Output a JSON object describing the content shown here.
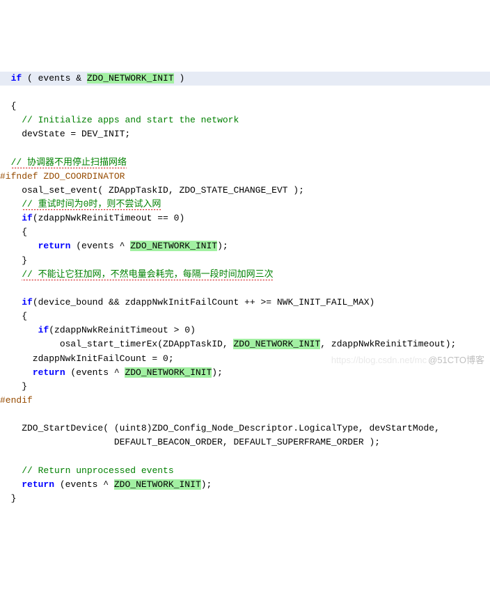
{
  "lines": {
    "l0a": "if",
    "l0b": " ( events & ",
    "l0c": "ZDO_NETWORK_INIT",
    "l0d": " )",
    "l1": "  {",
    "l2c": "// Initialize apps and start the network",
    "l3": "    devState = DEV_INIT;",
    "l5c": "// 协调器不用停止扫描网络",
    "l6": "#ifndef ZDO_COORDINATOR",
    "l7": "    osal_set_event( ZDAppTaskID, ZDO_STATE_CHANGE_EVT );",
    "l8c": "// 重试时间为0时，则不尝试入网",
    "l9a": "if",
    "l9b": "(zdappNwkReinitTimeout == ",
    "l9c": "0",
    "l9d": ")",
    "l10": "    {",
    "l11a": "return",
    "l11b": " (events ^ ",
    "l11c": "ZDO_NETWORK_INIT",
    "l11d": ");",
    "l12": "    }",
    "l13c": "// 不能让它狂加网，不然电量会耗完，每隔一段时间加网三次",
    "l15a": "if",
    "l15b": "(device_bound && zdappNwkInitFailCount ++ >= NWK_INIT_FAIL_MAX)",
    "l16": "    {",
    "l17a": "if",
    "l17b": "(zdappNwkReinitTimeout > ",
    "l17c": "0",
    "l17d": ")",
    "l18a": "           osal_start_timerEx(ZDAppTaskID, ",
    "l18b": "ZDO_NETWORK_INIT",
    "l18c": ", zdappNwkReinitTimeout);",
    "l19a": "      zdappNwkInitFailCount = ",
    "l19b": "0",
    "l19c": ";",
    "l20a": "return",
    "l20b": " (events ^ ",
    "l20c": "ZDO_NETWORK_INIT",
    "l20d": ");",
    "l21": "    }",
    "l22": "#endif",
    "l24": "    ZDO_StartDevice( (uint8)ZDO_Config_Node_Descriptor.LogicalType, devStartMode,",
    "l25": "                     DEFAULT_BEACON_ORDER, DEFAULT_SUPERFRAME_ORDER );",
    "l27c": "// Return unprocessed events",
    "l28a": "return",
    "l28b": " (events ^ ",
    "l28c": "ZDO_NETWORK_INIT",
    "l28d": ");",
    "l29": "  }"
  },
  "watermark": {
    "light": "https://blog.csdn.net/mc",
    "dark": "@51CTO博客"
  }
}
